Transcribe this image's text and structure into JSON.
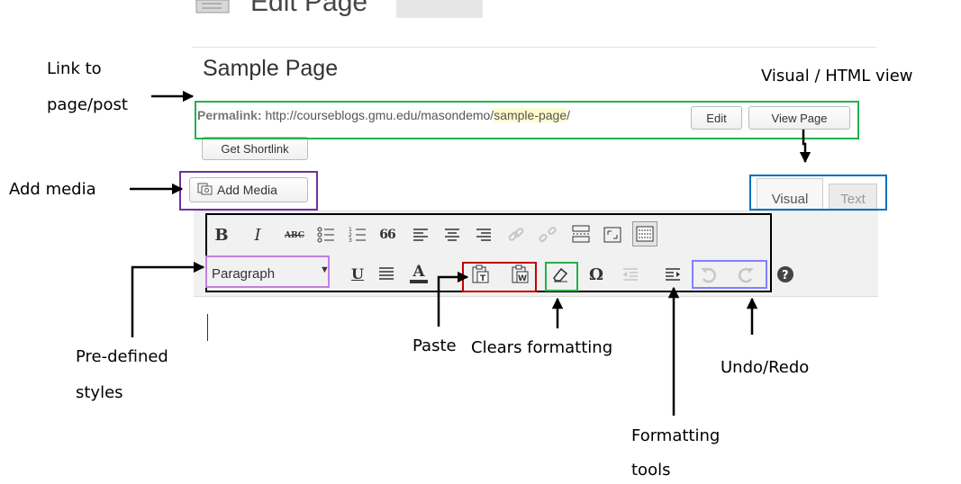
{
  "editor": {
    "heading": "Edit Page",
    "title": "Sample Page",
    "permalink": {
      "label": "Permalink:",
      "url_base": "http://courseblogs.gmu.edu/masondemo/",
      "slug": "sample-page",
      "url_end": "/"
    },
    "buttons": {
      "edit": "Edit",
      "view_page": "View Page",
      "get_shortlink": "Get Shortlink",
      "add_media": "Add Media"
    },
    "tabs": {
      "visual": "Visual",
      "text": "Text"
    },
    "toolbar": {
      "bold": "B",
      "italic": "I",
      "strikethrough": "ABC",
      "blockquote": "66",
      "underline": "U",
      "text_color": "A",
      "special_char": "Ω",
      "format_select": "Paragraph"
    }
  },
  "annotations": {
    "link_to_line1": "Link to",
    "link_to_line2": "page/post",
    "visual_html": "Visual / HTML view",
    "add_media": "Add media",
    "predefined_line1": "Pre-defined",
    "predefined_line2": "styles",
    "paste": "Paste",
    "clears": "Clears formatting",
    "undo_redo": "Undo/Redo",
    "formatting_line1": "Formatting",
    "formatting_line2": "tools"
  },
  "colors": {
    "green_box": "#22b14c",
    "purple_box": "#7030a0",
    "blue_box": "#0070c0",
    "red_box": "#c00000",
    "lilac_box": "#c080e0",
    "periwinkle_box": "#8080ff",
    "black_box": "#000000",
    "slug_highlight": "#fffbcc"
  }
}
